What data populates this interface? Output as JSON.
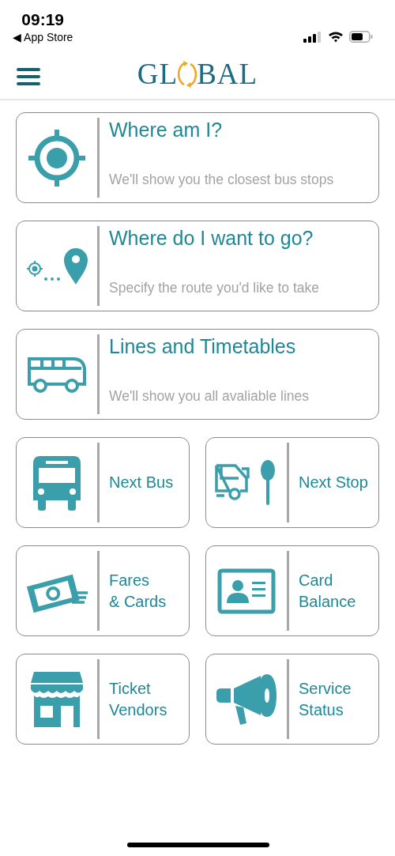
{
  "status_bar": {
    "time": "09:19",
    "back_link": "◀ App Store"
  },
  "header": {
    "logo_left": "GL",
    "logo_right": "BAL"
  },
  "wide_cards": [
    {
      "title": "Where am I?",
      "subtitle": "We'll show you the closest bus stops"
    },
    {
      "title": "Where do I want to go?",
      "subtitle": "Specify the route you'd like to take"
    },
    {
      "title": "Lines and Timetables",
      "subtitle": "We'll show you all avaliable lines"
    }
  ],
  "small_cards": [
    {
      "lines": [
        "Next Bus"
      ]
    },
    {
      "lines": [
        "Next Stop"
      ]
    },
    {
      "lines": [
        "Fares",
        "& Cards"
      ]
    },
    {
      "lines": [
        "Card",
        "Balance"
      ]
    },
    {
      "lines": [
        "Ticket",
        "Vendors"
      ]
    },
    {
      "lines": [
        "Service",
        "Status"
      ]
    }
  ]
}
